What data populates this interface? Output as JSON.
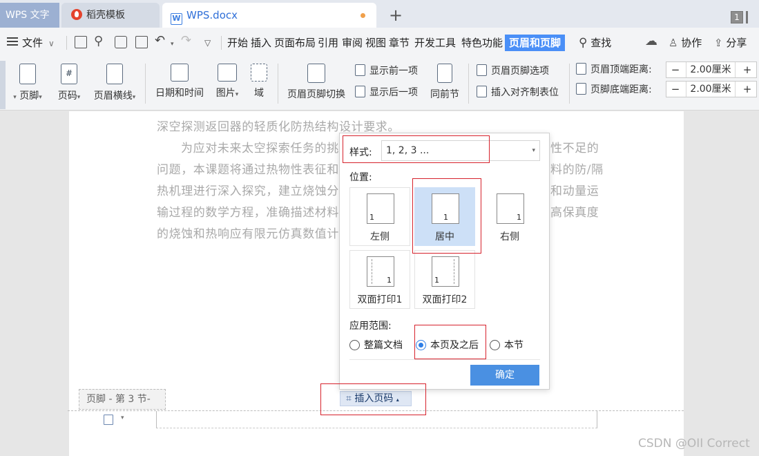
{
  "tabs": {
    "wps": "WPS 文字",
    "template": "稻壳模板",
    "doc": "WPS.docx",
    "add": "+",
    "window_count": "1"
  },
  "menu": {
    "file": "文件",
    "items": [
      "开始",
      "插入",
      "页面布局",
      "引用",
      "审阅",
      "视图",
      "章节",
      "开发工具",
      "特色功能",
      "页眉和页脚"
    ],
    "active": "页眉和页脚",
    "search": "查找",
    "collab": "协作",
    "share": "分享"
  },
  "ribbon": {
    "footer": "页脚",
    "page_num": "页码",
    "header_line": "页眉横线",
    "datetime": "日期和时间",
    "picture": "图片",
    "field": "域",
    "switch": "页眉页脚切换",
    "show_prev": "显示前一项",
    "show_next": "显示后一项",
    "same_prev": "同前节",
    "options": "页眉页脚选项",
    "insert_tab": "插入对齐制表位",
    "header_top_label": "页眉顶端距离:",
    "header_top_value": "2.00厘米",
    "footer_bottom_label": "页脚底端距离:",
    "footer_bottom_value": "2.00厘米"
  },
  "document": {
    "lines": [
      "深空探测返回器的轻质化防热结构设计要求。",
      "为应对未来太空探索任务的挑",
      "问题，本课题将通过热物性表征和",
      "热机理进行深入探究，建立烧蚀分",
      "输过程的数学方程，准确描述材料",
      "的烧蚀和热响应有限元仿真数值计"
    ],
    "right_fragments": [
      "性不足的",
      "料的防/隔",
      "和动量运",
      "高保真度"
    ],
    "footer_tag": "页脚  - 第 3 节-",
    "insert_page_number": "插入页码"
  },
  "popup": {
    "style_label": "样式:",
    "style_value": "1, 2, 3 ...",
    "position_label": "位置:",
    "positions": [
      {
        "label": "左侧",
        "num": "1"
      },
      {
        "label": "居中",
        "num": "1"
      },
      {
        "label": "右侧",
        "num": "1"
      },
      {
        "label": "双面打印1",
        "num": "1"
      },
      {
        "label": "双面打印2",
        "num": "1"
      }
    ],
    "selected_position": "居中",
    "scope_label": "应用范围:",
    "scope_options": [
      "整篇文档",
      "本页及之后",
      "本节"
    ],
    "selected_scope": "本页及之后",
    "ok": "确定"
  },
  "watermark": "CSDN @OII Correct",
  "colors": {
    "accent": "#4a8ff7",
    "annotation": "#d6212b",
    "selected_bg": "#cde0f7"
  }
}
